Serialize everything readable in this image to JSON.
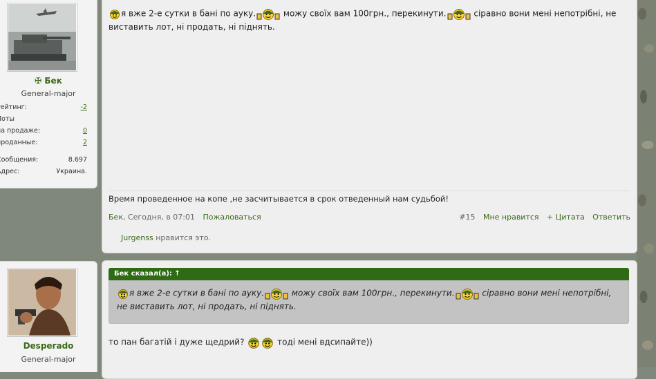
{
  "post1": {
    "user": {
      "name": "Бек",
      "rank": "General-major",
      "stats": [
        {
          "label": "Рейтинг:",
          "value": "-2",
          "link": true
        },
        {
          "label": "Лоты",
          "value": "",
          "link": false
        },
        {
          "label": "на продаже:",
          "value": "0",
          "link": true
        },
        {
          "label": "проданные:",
          "value": "2",
          "link": true
        },
        {
          "label": "Сообщения:",
          "value": "8.697",
          "link": false
        },
        {
          "label": "Адрес:",
          "value": "Украина.",
          "link": false
        }
      ]
    },
    "message": {
      "part1": "я вже 2-е сутки в бані по ауку.",
      "part2": " можу своїх вам 100грн., перекинути.",
      "part3": " сіравно вони мені непотрібні, не виставить лот, ні продать, ні піднять."
    },
    "signature": "Время проведенное на копе ,не засчитывается в срок отведенный нам судьбой!",
    "meta": {
      "author": "Бек",
      "time": ", Сегодня, в 07:01",
      "report": "Пожаловаться",
      "post_number": "#15",
      "like": "Мне нравится",
      "quote": "+ Цитата",
      "reply": "Ответить"
    },
    "likes": {
      "user": "Jurgenss",
      "text": " нравится это."
    }
  },
  "post2": {
    "user": {
      "name": "Desperado",
      "rank": "General-major"
    },
    "quote_header": "Бек сказал(а): ↑",
    "quote": {
      "part1": "я вже 2-е сутки в бані по ауку.",
      "part2": " можу своїх вам 100грн., перекинути.",
      "part3": " сіравно вони мені непотрібні, не виставить лот, ні продать, ні піднять."
    },
    "reply": {
      "part1": "то пан багатій і дуже щедрий? ",
      "part2": " тоді мені вдсипайте))"
    }
  },
  "colors": {
    "accent": "#3a6a18",
    "quote_header": "#2f6a14"
  }
}
